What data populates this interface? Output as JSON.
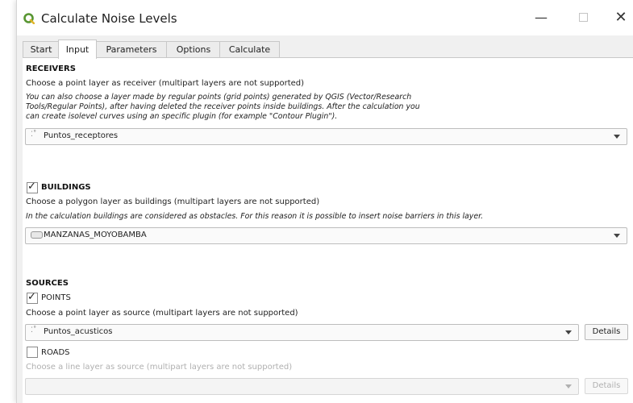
{
  "window": {
    "title": "Calculate Noise Levels",
    "minimize_glyph": "—",
    "close_glyph": "✕"
  },
  "tabs": [
    {
      "label": "Start"
    },
    {
      "label": "Input",
      "active": true
    },
    {
      "label": "Parameters"
    },
    {
      "label": "Options"
    },
    {
      "label": "Calculate"
    }
  ],
  "receivers": {
    "header": "RECEIVERS",
    "instruction": "Choose a point layer as receiver (multipart layers are not supported)",
    "note_lines": [
      "You can also choose a layer made by regular points (grid points) generated by QGIS (Vector/Research",
      "Tools/Regular Points), after having deleted the receiver points inside buildings. After the calculation you",
      "can create isolevel curves using an specific plugin (for example \"Contour Plugin\")."
    ],
    "layer": "Puntos_receptores",
    "layer_icon": "point-layer-icon"
  },
  "buildings": {
    "header": "BUILDINGS",
    "checked": true,
    "instruction": "Choose a polygon layer as buildings (multipart layers are not supported)",
    "note": "In the calculation buildings are considered as obstacles. For this reason it is possible to insert noise barriers in this layer.",
    "layer": "MANZANAS_MOYOBAMBA",
    "layer_icon": "polygon-layer-icon"
  },
  "sources": {
    "header": "SOURCES",
    "points": {
      "label": "POINTS",
      "checked": true,
      "instruction": "Choose a point layer as source (multipart layers are not supported)",
      "layer": "Puntos_acusticos",
      "details_label": "Details"
    },
    "roads": {
      "label": "ROADS",
      "checked": false,
      "instruction": "Choose a line layer as source (multipart layers are not supported)",
      "layer": "",
      "details_label": "Details"
    }
  },
  "colors": {
    "accent_logo": "#589632",
    "disabled_text": "#b0b0b0"
  },
  "check_glyph": "✓"
}
